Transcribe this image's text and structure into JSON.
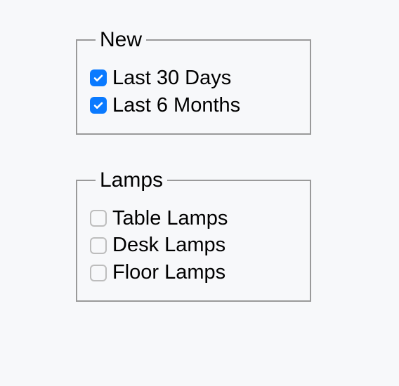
{
  "groups": [
    {
      "legend": "New",
      "items": [
        {
          "label": "Last 30 Days",
          "checked": true
        },
        {
          "label": "Last 6 Months",
          "checked": true
        }
      ]
    },
    {
      "legend": "Lamps",
      "items": [
        {
          "label": "Table Lamps",
          "checked": false
        },
        {
          "label": "Desk Lamps",
          "checked": false
        },
        {
          "label": "Floor Lamps",
          "checked": false
        }
      ]
    }
  ]
}
